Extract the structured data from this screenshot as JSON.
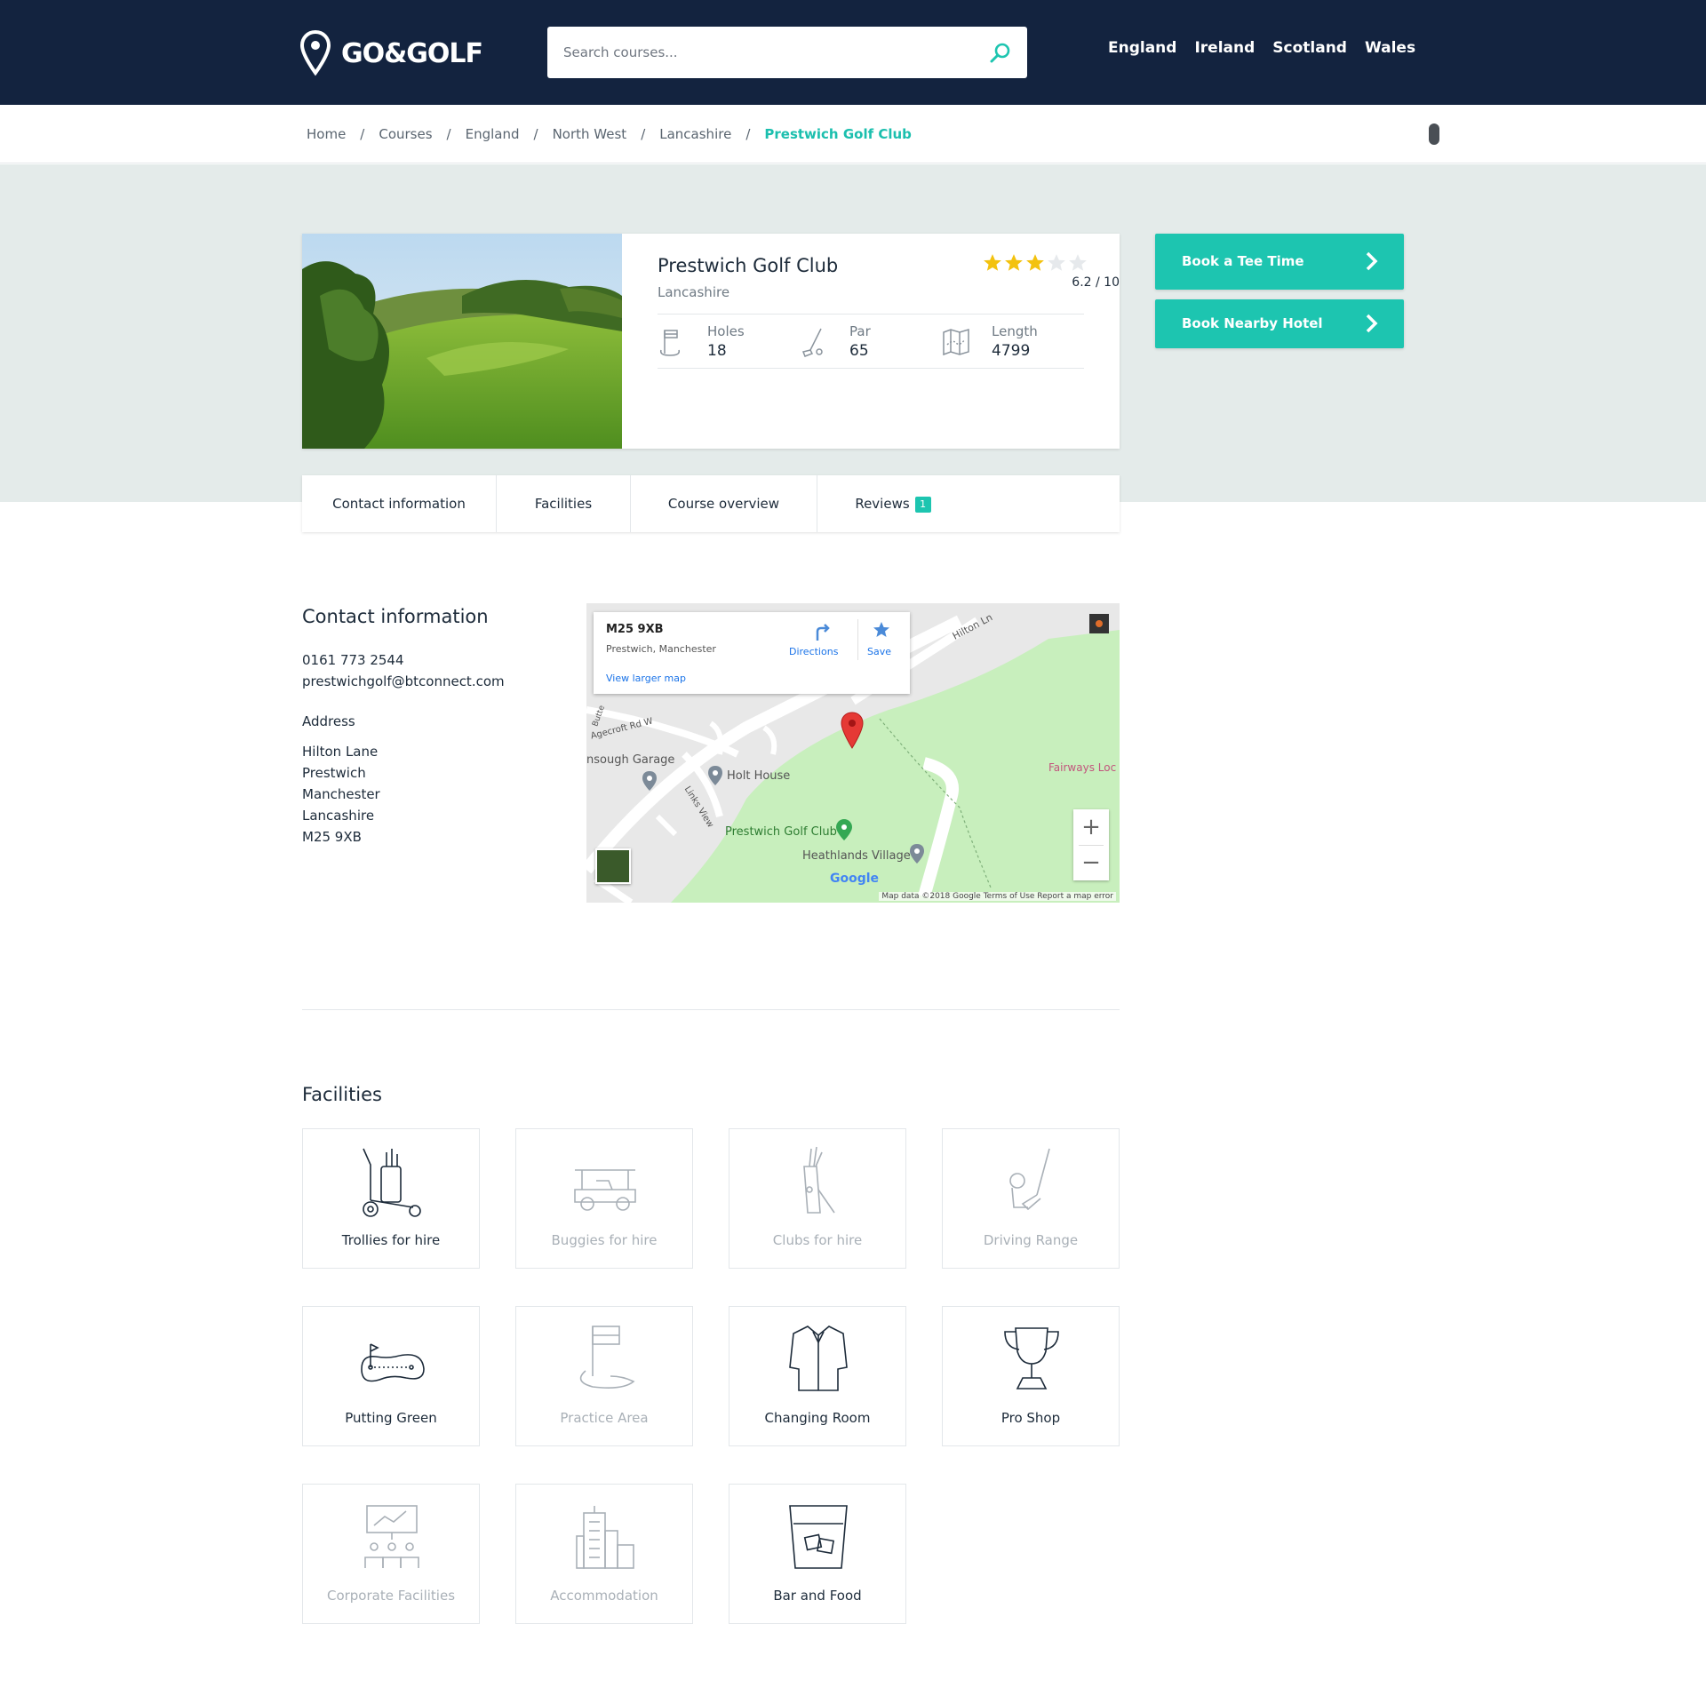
{
  "header": {
    "brand": "GO&GOLF",
    "search_placeholder": "Search courses...",
    "nav": [
      "England",
      "Ireland",
      "Scotland",
      "Wales"
    ]
  },
  "breadcrumb": {
    "items": [
      "Home",
      "Courses",
      "England",
      "North West",
      "Lancashire"
    ],
    "current": "Prestwich Golf Club"
  },
  "course": {
    "name": "Prestwich Golf Club",
    "county": "Lancashire",
    "stars_filled": 3,
    "stars_total": 5,
    "rating": "6.2 / 10",
    "stats": [
      {
        "label": "Holes",
        "value": "18",
        "icon": "flag-icon"
      },
      {
        "label": "Par",
        "value": "65",
        "icon": "golf-club-icon"
      },
      {
        "label": "Length",
        "value": "4799",
        "icon": "map-icon"
      }
    ]
  },
  "actions": {
    "tee_time": "Book a Tee Time",
    "hotel": "Book Nearby Hotel"
  },
  "tabs": {
    "contact": "Contact information",
    "facilities": "Facilities",
    "overview": "Course overview",
    "reviews": "Reviews",
    "reviews_count": "1"
  },
  "contact": {
    "title": "Contact information",
    "phone": "0161 773 2544",
    "email": "prestwichgolf@btconnect.com",
    "address_title": "Address",
    "address": [
      "Hilton Lane",
      "Prestwich",
      "Manchester",
      "Lancashire",
      "M25 9XB"
    ]
  },
  "map": {
    "postcode": "M25 9XB",
    "area": "Prestwich, Manchester",
    "directions": "Directions",
    "save": "Save",
    "view_larger": "View larger map",
    "labels": {
      "hilton_ln": "Hilton Ln",
      "agecroft": "Agecroft Rd W",
      "garage": "nsough Garage",
      "holt_house": "Holt House",
      "links_view": "Links View",
      "golf_club": "Prestwich Golf Club",
      "heathlands": "Heathlands Village",
      "fairways": "Fairways Loc",
      "butter": "Butte"
    },
    "google": "Google",
    "footer": "Map data ©2018 Google   Terms of Use   Report a map error"
  },
  "facilities": {
    "title": "Facilities",
    "items": [
      {
        "label": "Trollies for hire",
        "available": true,
        "icon": "trolley-icon"
      },
      {
        "label": "Buggies for hire",
        "available": false,
        "icon": "buggy-icon"
      },
      {
        "label": "Clubs for hire",
        "available": false,
        "icon": "golf-bag-icon"
      },
      {
        "label": "Driving Range",
        "available": false,
        "icon": "driving-range-icon"
      },
      {
        "label": "Putting Green",
        "available": true,
        "icon": "putting-green-icon"
      },
      {
        "label": "Practice Area",
        "available": false,
        "icon": "practice-flag-icon"
      },
      {
        "label": "Changing Room",
        "available": true,
        "icon": "shirt-icon"
      },
      {
        "label": "Pro Shop",
        "available": true,
        "icon": "trophy-icon"
      },
      {
        "label": "Corporate Facilities",
        "available": false,
        "icon": "presentation-icon"
      },
      {
        "label": "Accommodation",
        "available": false,
        "icon": "buildings-icon"
      },
      {
        "label": "Bar and Food",
        "available": true,
        "icon": "glass-icon"
      }
    ]
  },
  "colors": {
    "header_bg": "#13233f",
    "accent": "#1dc5b0",
    "star": "#f3c20f",
    "band": "#e4ebea"
  }
}
